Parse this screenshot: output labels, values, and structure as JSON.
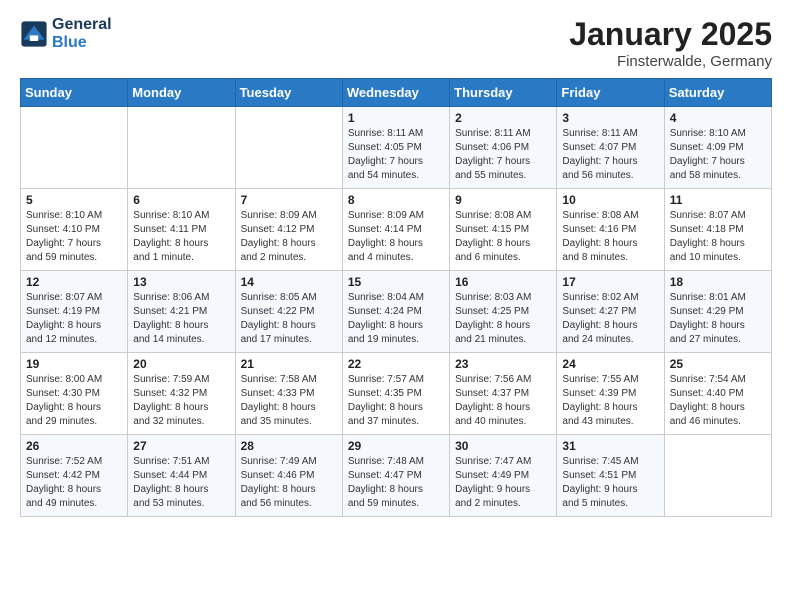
{
  "logo": {
    "line1": "General",
    "line2": "Blue"
  },
  "title": "January 2025",
  "subtitle": "Finsterwalde, Germany",
  "weekdays": [
    "Sunday",
    "Monday",
    "Tuesday",
    "Wednesday",
    "Thursday",
    "Friday",
    "Saturday"
  ],
  "weeks": [
    [
      {
        "day": "",
        "info": ""
      },
      {
        "day": "",
        "info": ""
      },
      {
        "day": "",
        "info": ""
      },
      {
        "day": "1",
        "info": "Sunrise: 8:11 AM\nSunset: 4:05 PM\nDaylight: 7 hours\nand 54 minutes."
      },
      {
        "day": "2",
        "info": "Sunrise: 8:11 AM\nSunset: 4:06 PM\nDaylight: 7 hours\nand 55 minutes."
      },
      {
        "day": "3",
        "info": "Sunrise: 8:11 AM\nSunset: 4:07 PM\nDaylight: 7 hours\nand 56 minutes."
      },
      {
        "day": "4",
        "info": "Sunrise: 8:10 AM\nSunset: 4:09 PM\nDaylight: 7 hours\nand 58 minutes."
      }
    ],
    [
      {
        "day": "5",
        "info": "Sunrise: 8:10 AM\nSunset: 4:10 PM\nDaylight: 7 hours\nand 59 minutes."
      },
      {
        "day": "6",
        "info": "Sunrise: 8:10 AM\nSunset: 4:11 PM\nDaylight: 8 hours\nand 1 minute."
      },
      {
        "day": "7",
        "info": "Sunrise: 8:09 AM\nSunset: 4:12 PM\nDaylight: 8 hours\nand 2 minutes."
      },
      {
        "day": "8",
        "info": "Sunrise: 8:09 AM\nSunset: 4:14 PM\nDaylight: 8 hours\nand 4 minutes."
      },
      {
        "day": "9",
        "info": "Sunrise: 8:08 AM\nSunset: 4:15 PM\nDaylight: 8 hours\nand 6 minutes."
      },
      {
        "day": "10",
        "info": "Sunrise: 8:08 AM\nSunset: 4:16 PM\nDaylight: 8 hours\nand 8 minutes."
      },
      {
        "day": "11",
        "info": "Sunrise: 8:07 AM\nSunset: 4:18 PM\nDaylight: 8 hours\nand 10 minutes."
      }
    ],
    [
      {
        "day": "12",
        "info": "Sunrise: 8:07 AM\nSunset: 4:19 PM\nDaylight: 8 hours\nand 12 minutes."
      },
      {
        "day": "13",
        "info": "Sunrise: 8:06 AM\nSunset: 4:21 PM\nDaylight: 8 hours\nand 14 minutes."
      },
      {
        "day": "14",
        "info": "Sunrise: 8:05 AM\nSunset: 4:22 PM\nDaylight: 8 hours\nand 17 minutes."
      },
      {
        "day": "15",
        "info": "Sunrise: 8:04 AM\nSunset: 4:24 PM\nDaylight: 8 hours\nand 19 minutes."
      },
      {
        "day": "16",
        "info": "Sunrise: 8:03 AM\nSunset: 4:25 PM\nDaylight: 8 hours\nand 21 minutes."
      },
      {
        "day": "17",
        "info": "Sunrise: 8:02 AM\nSunset: 4:27 PM\nDaylight: 8 hours\nand 24 minutes."
      },
      {
        "day": "18",
        "info": "Sunrise: 8:01 AM\nSunset: 4:29 PM\nDaylight: 8 hours\nand 27 minutes."
      }
    ],
    [
      {
        "day": "19",
        "info": "Sunrise: 8:00 AM\nSunset: 4:30 PM\nDaylight: 8 hours\nand 29 minutes."
      },
      {
        "day": "20",
        "info": "Sunrise: 7:59 AM\nSunset: 4:32 PM\nDaylight: 8 hours\nand 32 minutes."
      },
      {
        "day": "21",
        "info": "Sunrise: 7:58 AM\nSunset: 4:33 PM\nDaylight: 8 hours\nand 35 minutes."
      },
      {
        "day": "22",
        "info": "Sunrise: 7:57 AM\nSunset: 4:35 PM\nDaylight: 8 hours\nand 37 minutes."
      },
      {
        "day": "23",
        "info": "Sunrise: 7:56 AM\nSunset: 4:37 PM\nDaylight: 8 hours\nand 40 minutes."
      },
      {
        "day": "24",
        "info": "Sunrise: 7:55 AM\nSunset: 4:39 PM\nDaylight: 8 hours\nand 43 minutes."
      },
      {
        "day": "25",
        "info": "Sunrise: 7:54 AM\nSunset: 4:40 PM\nDaylight: 8 hours\nand 46 minutes."
      }
    ],
    [
      {
        "day": "26",
        "info": "Sunrise: 7:52 AM\nSunset: 4:42 PM\nDaylight: 8 hours\nand 49 minutes."
      },
      {
        "day": "27",
        "info": "Sunrise: 7:51 AM\nSunset: 4:44 PM\nDaylight: 8 hours\nand 53 minutes."
      },
      {
        "day": "28",
        "info": "Sunrise: 7:49 AM\nSunset: 4:46 PM\nDaylight: 8 hours\nand 56 minutes."
      },
      {
        "day": "29",
        "info": "Sunrise: 7:48 AM\nSunset: 4:47 PM\nDaylight: 8 hours\nand 59 minutes."
      },
      {
        "day": "30",
        "info": "Sunrise: 7:47 AM\nSunset: 4:49 PM\nDaylight: 9 hours\nand 2 minutes."
      },
      {
        "day": "31",
        "info": "Sunrise: 7:45 AM\nSunset: 4:51 PM\nDaylight: 9 hours\nand 5 minutes."
      },
      {
        "day": "",
        "info": ""
      }
    ]
  ]
}
